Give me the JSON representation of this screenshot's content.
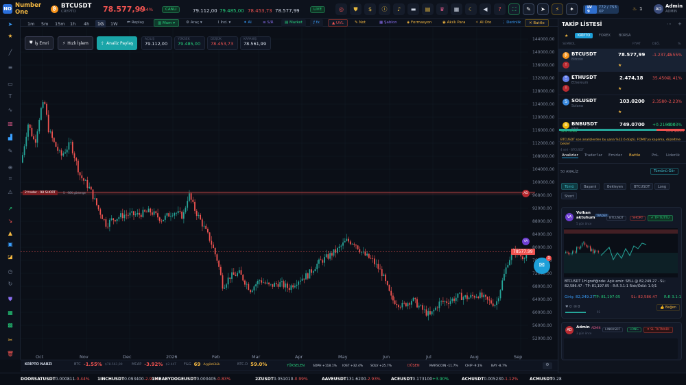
{
  "brand": {
    "logo_text": "NO",
    "name": "Number One"
  },
  "symbol": {
    "name": "BTCUSDT",
    "sub": "CRYPTO",
    "coin_glyph": "₿",
    "price": "78.577,99",
    "change": "-1.54%",
    "live": "CANLI"
  },
  "ohlc": [
    "79.112,00",
    "79.485,00",
    "78.453,73",
    "78.577,99"
  ],
  "ohlc_colors": [
    "#dbe2ee",
    "#26d07c",
    "#ef5350",
    "#dbe2ee"
  ],
  "top_live": "LIVE",
  "level": {
    "lv": "LV 9",
    "xp": "772 / 753 XP",
    "count": "1"
  },
  "user": {
    "initials": "AD",
    "name": "Admin",
    "role": "ADMIN"
  },
  "timeframes": [
    "1m",
    "5m",
    "15m",
    "1h",
    "4h",
    "1G",
    "1W"
  ],
  "toolbar": {
    "replay": "Replay",
    "mum": "Mum",
    "arac": "Araç",
    "indi": "İnd.",
    "ai": "AI",
    "sr": "S/R",
    "market": "Market",
    "fx": "fx",
    "uvl": "UVL",
    "not": "Not",
    "sablon": "Şablon",
    "formasyon": "Formasyon",
    "akilli": "Akıllı Para",
    "ai_oto": "AI Oto",
    "derinlik": "Derinlik",
    "battle": "Battle"
  },
  "trade_buttons": {
    "is_emri": "İş Emri",
    "hizli": "Hızlı İşlem",
    "analiz": "Analiz Paylaş"
  },
  "ohlc_boxes": [
    {
      "l": "AÇILIŞ",
      "v": "79.112,00"
    },
    {
      "l": "YÜKSEK",
      "v": "79.485,00"
    },
    {
      "l": "DÜŞÜK",
      "v": "78.453,73"
    },
    {
      "l": "KAPANIŞ",
      "v": "78.561,99"
    }
  ],
  "y_labels": [
    "144000.00",
    "140000.00",
    "136000.00",
    "132000.00",
    "128000.00",
    "124000.00",
    "120000.00",
    "116000.00",
    "112000.00",
    "108000.00",
    "104000.00",
    "100000.00",
    "96800.00",
    "92000.00",
    "88000.00",
    "84000.00",
    "80000.00",
    "76000.00",
    "72000.00",
    "68000.00",
    "64000.00",
    "60000.00",
    "56000.00",
    "52000.00"
  ],
  "x_labels": [
    "Oct",
    "Nov",
    "Dec",
    "2026",
    "Feb",
    "Mar",
    "Apr",
    "May",
    "Jun",
    "Jul",
    "Aug",
    "Sep"
  ],
  "price_tag": "78577.99",
  "sl_tag": "2 trader · 98 SHORT",
  "sl_tag_small": "5 · 96K gösterge",
  "ticker": {
    "title": "KRİPTO NABZI",
    "btc_l": "BTC",
    "btc_v": "-1.55%",
    "btc_s": "$78.561,99",
    "mcap_l": "MCAP",
    "mcap_v": "-3.92%",
    "mcap_s": "$2.44T",
    "fg_l": "F&G",
    "fg_v": "69",
    "fg_s": "Açgözlülük",
    "dom_l": "BTC.D",
    "dom_v": "59.0%",
    "up": "YÜKSELEN",
    "up_items": [
      "SOPH +118.1%",
      "IOST +32.4%",
      "SOLV +25.7%"
    ],
    "down": "DÜŞEN",
    "down_items": [
      "MARSCOIN -11.7%",
      "CHIP -9.1%",
      "BAY -8.7%"
    ]
  },
  "tape": [
    {
      "n": "DOORSATUSDT",
      "p": "0.000811",
      "c": "-0.44%"
    },
    {
      "n": "1INCHUSDT",
      "p": "0.093400",
      "c": "-2.91%"
    },
    {
      "n": "1MBABYDOGEUSDT",
      "p": "0.000405",
      "c": "-0.83%"
    },
    {
      "n": "2ZUSDT",
      "p": "0.051010",
      "c": "-0.99%"
    },
    {
      "n": "AAVEUSDT",
      "p": "131.6200",
      "c": "-2.93%"
    },
    {
      "n": "ACEUSDT",
      "p": "0.173100",
      "c": "+3.90%"
    },
    {
      "n": "ACHUSDT",
      "p": "0.005230",
      "c": "-1.12%"
    },
    {
      "n": "ACMUSDT",
      "p": "0.28",
      "c": ""
    }
  ],
  "watch": {
    "title": "TAKİP LİSTESİ",
    "tabs": [
      "KRİPTO",
      "FOREX",
      "BORSA"
    ],
    "cols": [
      "SEMBOL",
      "FİYAT",
      "DEĞ.",
      "%"
    ],
    "rows": [
      {
        "n": "BTCUSDT",
        "s": "Bitcoin",
        "p": "78.577,99",
        "c1": "-1.237,45",
        "c2": "-1.55%",
        "ic": "#f7931a",
        "g": "₿"
      },
      {
        "n": "ETHUSDT",
        "s": "Ethereum",
        "p": "2.474,18",
        "c1": "35.4500",
        "c2": "-1.41%",
        "ic": "#627eea",
        "g": "Ξ"
      },
      {
        "n": "SOLUSDT",
        "s": "Solana",
        "p": "103.0200",
        "c1": "2.3580",
        "c2": "-2.23%",
        "ic": "#3a8ae0",
        "g": "S"
      },
      {
        "n": "BNBUSDT",
        "s": "BNB",
        "p": "749.0700",
        "c1": "+0.210000",
        "c2": "+0.03%",
        "ic": "#f0b90b",
        "g": "B"
      }
    ],
    "long_short": {
      "long": "58% LONG",
      "short": "42% SHORT"
    },
    "alert": "BTCUSDT son analizlerden bu yana %12.6 düştü. FOMO'ya kapılma, düzeltme bekle!",
    "footer_small": "4 veri · BTCUSDT"
  },
  "ptabs": [
    "Analizler",
    "Trader'lar",
    "Emirler",
    "Battle",
    "PnL",
    "Liderlik"
  ],
  "panalyses_count": "50 ANALİZ",
  "tumunu_gor": "Tümünü Gör",
  "filters": [
    "Tümü",
    "Başarılı",
    "Bekleyen",
    "BTCUSDT",
    "Long",
    "Short"
  ],
  "card1": {
    "initials": "VA",
    "name": "Volkan aktuhum",
    "badge": "TRADER",
    "time": "5 gün önce",
    "sym": "BTCUSDT",
    "side": "SHORT",
    "status": "TP TUTTU",
    "desc": "BTCUSDT 1H grafiğinde: Açık emir: SELL @ 82,249.27 - SL: 82,586.47 - TP: 81,197.05 - R:R 3.1:1 Risk/Ödül: 1.0/1",
    "giris": "Giriş: 82,249.27",
    "tp": "TP: 81,197.05",
    "sl": "SL: 82,586.47",
    "rr": "R:R 3.1:1",
    "likes": "0",
    "comments": "0",
    "izl": "Beğen",
    "views": "91"
  },
  "card2": {
    "initials": "AD",
    "name": "Admin",
    "badge": "ADMIN",
    "time": "3 gün önce",
    "sym": "LINKUSDT",
    "side": "LONG",
    "status": "SL TUTMADI"
  },
  "colors": {
    "accent": "#f5b942",
    "up": "#26a69a",
    "down": "#ef5350",
    "bg": "#0b0f17"
  },
  "icons": [
    "home-icon",
    "star-icon",
    "crosshair-icon",
    "bell-icon",
    "sun-icon",
    "gear-icon",
    "camera-icon",
    "fullscreen-icon"
  ]
}
